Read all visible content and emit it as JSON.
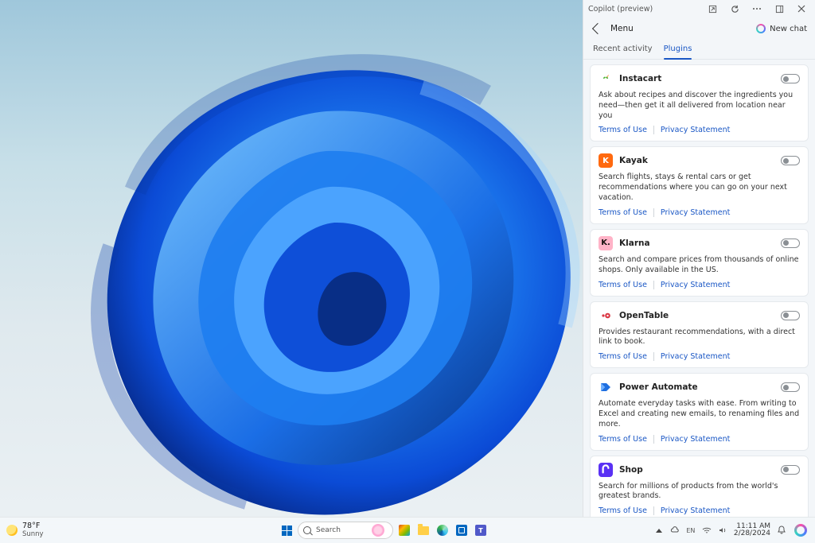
{
  "copilot": {
    "title": "Copilot (preview)",
    "menu_label": "Menu",
    "newchat_label": "New chat",
    "tabs": {
      "recent": "Recent activity",
      "plugins": "Plugins"
    },
    "links": {
      "terms": "Terms of Use",
      "privacy": "Privacy Statement"
    },
    "plugins": [
      {
        "name": "Instacart",
        "desc": "Ask about recipes and discover the ingredients you need—then get it all delivered from location near you"
      },
      {
        "name": "Kayak",
        "desc": "Search flights, stays & rental cars or get recommendations where you can go on your next vacation."
      },
      {
        "name": "Klarna",
        "desc": "Search and compare prices from thousands of online shops. Only available in the US."
      },
      {
        "name": "OpenTable",
        "desc": "Provides restaurant recommendations, with a direct link to book."
      },
      {
        "name": "Power Automate",
        "desc": "Automate everyday tasks with ease. From writing to Excel and creating new emails, to renaming files and more."
      },
      {
        "name": "Shop",
        "desc": "Search for millions of products from the world's greatest brands."
      }
    ]
  },
  "taskbar": {
    "weather": {
      "temp": "78°F",
      "cond": "Sunny"
    },
    "search_placeholder": "Search",
    "clock": {
      "time": "11:11 AM",
      "date": "2/28/2024"
    }
  }
}
